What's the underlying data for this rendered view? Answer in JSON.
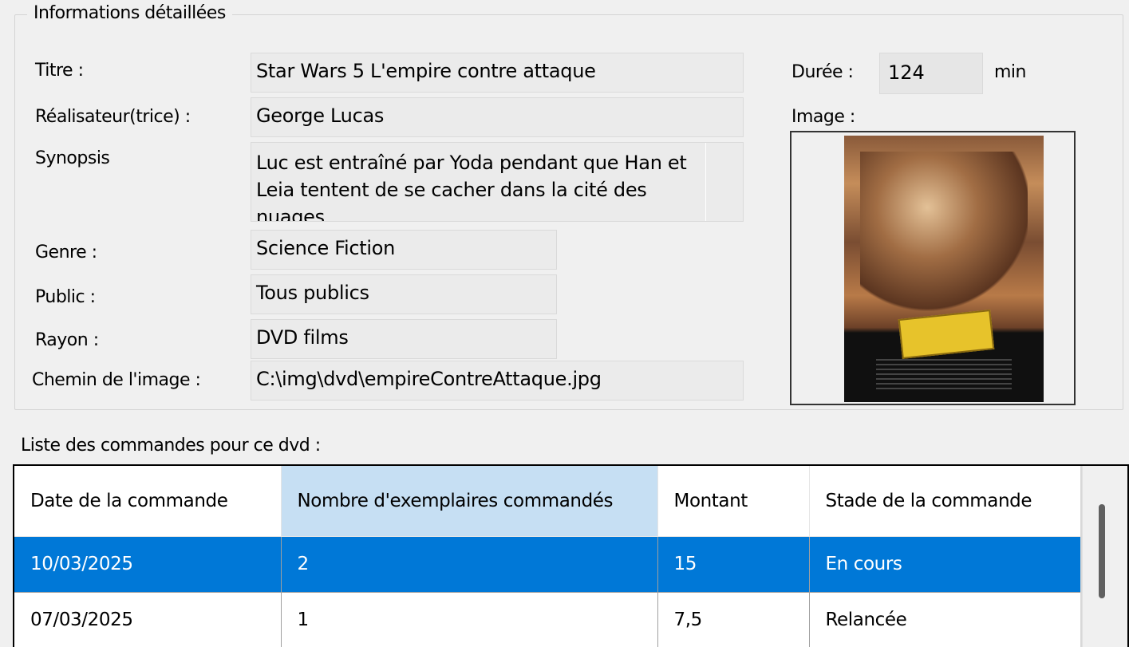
{
  "details": {
    "group_title": "Informations détaillées",
    "titre_label": "Titre :",
    "titre_value": "Star Wars 5 L'empire contre attaque",
    "realisateur_label": "Réalisateur(trice) :",
    "realisateur_value": "George Lucas",
    "synopsis_label": "Synopsis",
    "synopsis_value": "Luc est entraîné par Yoda pendant que Han et Leia tentent de se cacher dans la cité des nuages",
    "genre_label": "Genre :",
    "genre_value": "Science Fiction",
    "public_label": "Public :",
    "public_value": "Tous publics",
    "rayon_label": "Rayon :",
    "rayon_value": "DVD films",
    "chemin_label": "Chemin de l'image :",
    "chemin_value": "C:\\img\\dvd\\empireContreAttaque.jpg",
    "duree_label": "Durée :",
    "duree_value": "124",
    "duree_unit": "min",
    "image_label": "Image :"
  },
  "orders": {
    "label": "Liste des commandes pour ce dvd :",
    "columns": [
      "Date de la commande",
      "Nombre d'exemplaires commandés",
      "Montant",
      "Stade de la commande"
    ],
    "sorted_column_index": 1,
    "rows": [
      {
        "date": "10/03/2025",
        "nombre": "2",
        "montant": "15",
        "stade": "En cours",
        "selected": true
      },
      {
        "date": "07/03/2025",
        "nombre": "1",
        "montant": "7,5",
        "stade": "Relancée",
        "selected": false
      }
    ]
  },
  "colors": {
    "selection": "#0078d7",
    "sorted_header": "#c6dff3",
    "field_background": "#ebebeb",
    "window_background": "#f0f0f0"
  }
}
